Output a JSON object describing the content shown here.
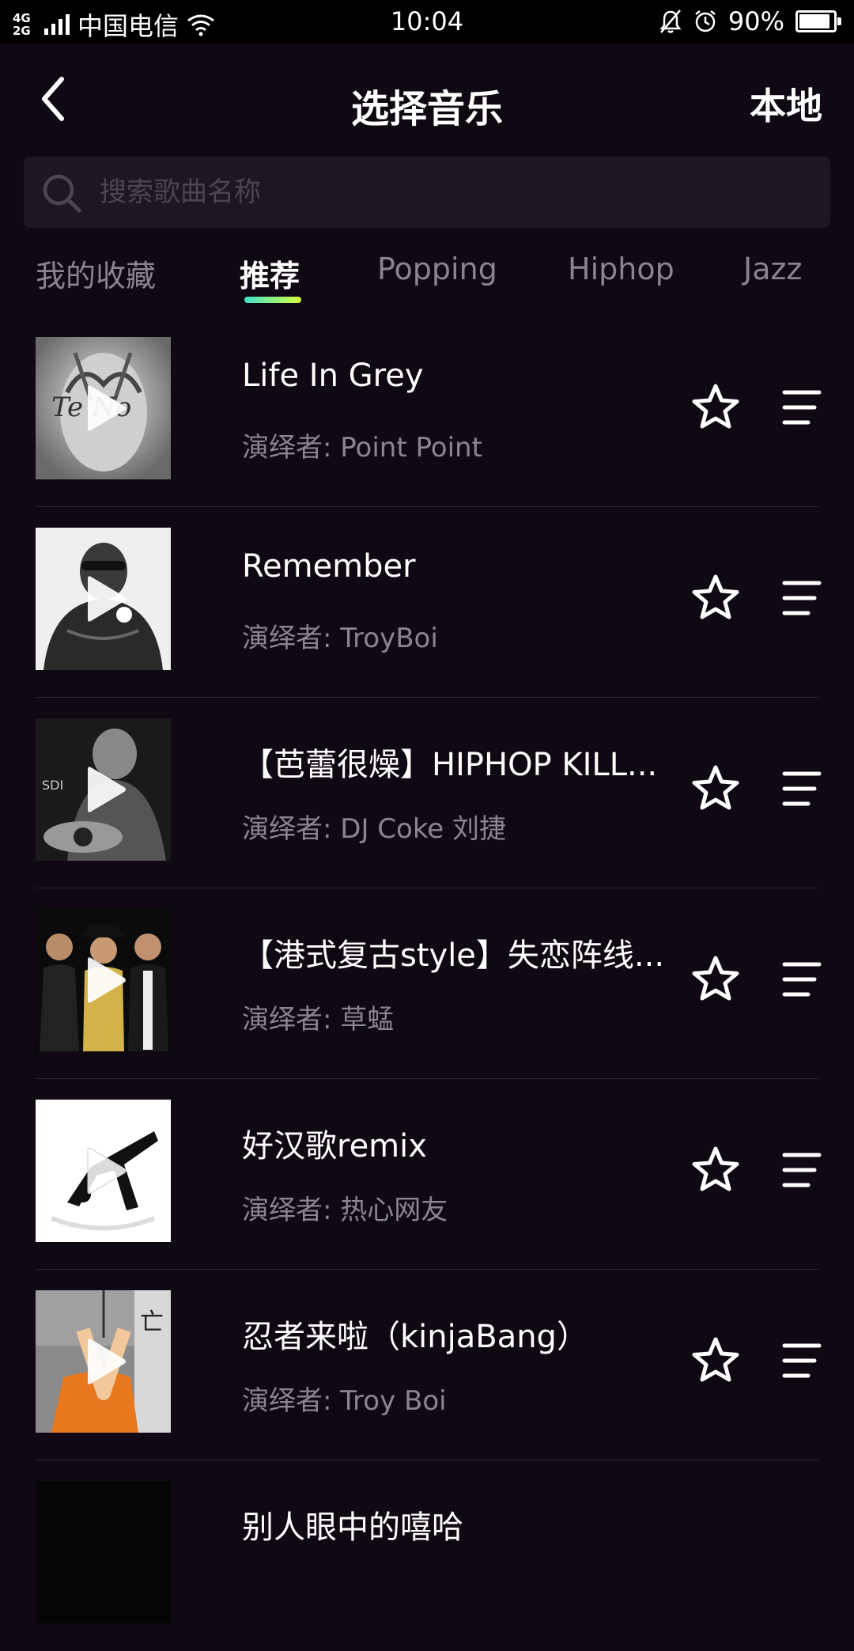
{
  "status_bar": {
    "network": "4G 2G",
    "carrier": "中国电信",
    "time": "10:04",
    "battery": "90%",
    "battery_level": 0.9,
    "icons": [
      "signal-icon",
      "wifi-icon",
      "silent-bell-icon",
      "alarm-icon",
      "battery-icon"
    ]
  },
  "header": {
    "back_icon": "back-chevron-icon",
    "title": "选择音乐",
    "local_label": "本地"
  },
  "search": {
    "placeholder": "搜索歌曲名称",
    "value": "",
    "icon": "search-icon"
  },
  "tabs": [
    {
      "label": "我的收藏",
      "active": false
    },
    {
      "label": "推荐",
      "active": true
    },
    {
      "label": "Popping",
      "active": false
    },
    {
      "label": "Hiphop",
      "active": false
    },
    {
      "label": "Jazz",
      "active": false
    }
  ],
  "songs": [
    {
      "title": "Life In Grey",
      "artist": "演绎者: Point Point"
    },
    {
      "title": "Remember",
      "artist": "演绎者: TroyBoi"
    },
    {
      "title": "【芭蕾很燥】HIPHOP KILL...",
      "artist": "演绎者: DJ Coke 刘捷"
    },
    {
      "title": "【港式复古style】失恋阵线...",
      "artist": "演绎者: 草蜢"
    },
    {
      "title": "好汉歌remix",
      "artist": "演绎者: 热心网友"
    },
    {
      "title": "忍者来啦（kinjaBang）",
      "artist": "演绎者: Troy Boi"
    },
    {
      "title": "别人眼中的嘻哈",
      "artist": ""
    }
  ],
  "row_icons": {
    "favorite": "star-outline-icon",
    "more": "menu-lines-icon",
    "play": "play-icon"
  },
  "colors": {
    "background": "#100812",
    "status_bar": "#000000",
    "search_bg": "#1e1723",
    "text_primary": "#ffffff",
    "text_secondary": "#8c8590",
    "tab_inactive": "#8a8390",
    "indicator_start": "#40e0c8",
    "indicator_end": "#d8ff40"
  }
}
